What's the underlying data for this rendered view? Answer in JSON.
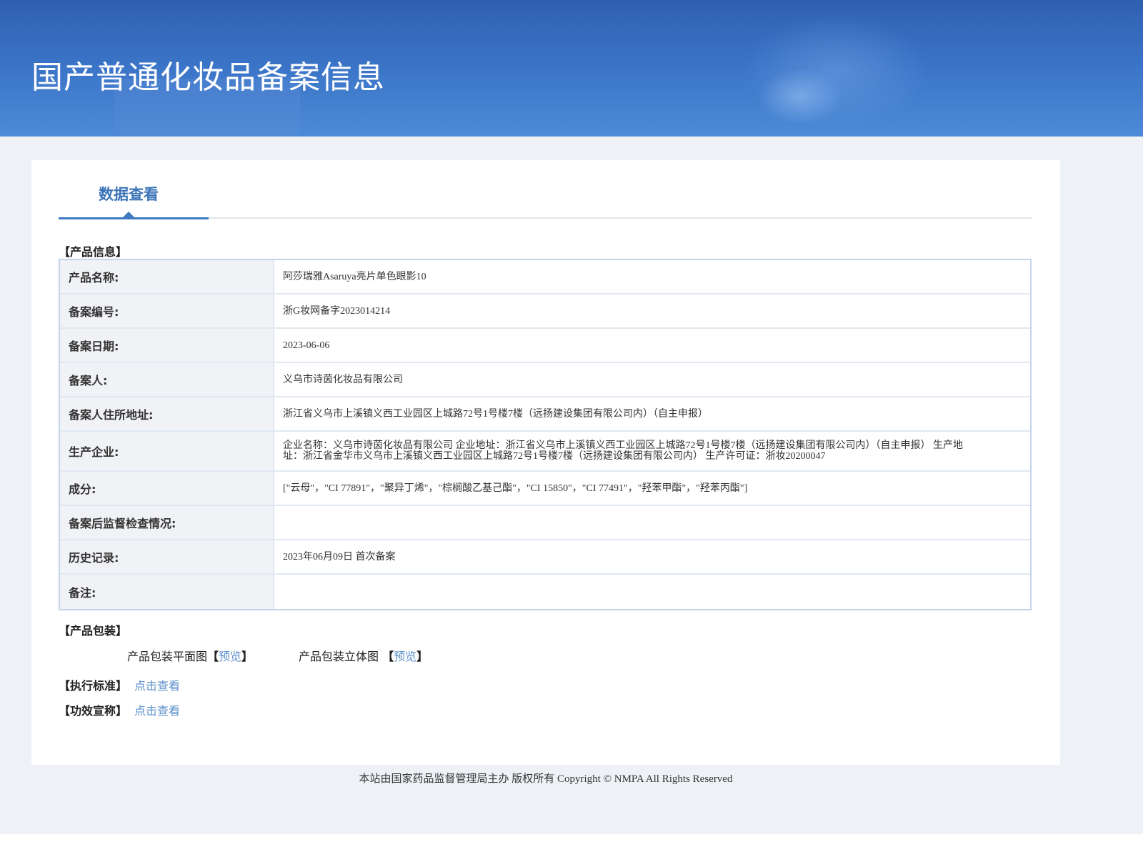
{
  "banner": {
    "title": "国产普通化妆品备案信息"
  },
  "tab": {
    "label": "数据查看"
  },
  "product_info": {
    "heading": "【产品信息】",
    "rows": [
      {
        "label": "产品名称:",
        "value": "阿莎瑞雅Asaruya亮片单色眼影10"
      },
      {
        "label": "备案编号:",
        "value": "浙G妆网备字2023014214"
      },
      {
        "label": "备案日期:",
        "value": "2023-06-06"
      },
      {
        "label": "备案人:",
        "value": "义乌市诗茵化妆品有限公司"
      },
      {
        "label": "备案人住所地址:",
        "value": "浙江省义乌市上溪镇义西工业园区上城路72号1号楼7楼（远扬建设集团有限公司内）（自主申报）"
      },
      {
        "label": "生产企业:",
        "value": "企业名称：义乌市诗茵化妆品有限公司 企业地址：浙江省义乌市上溪镇义西工业园区上城路72号1号楼7楼（远扬建设集团有限公司内）（自主申报） 生产地址：浙江省金华市义乌市上溪镇义西工业园区上城路72号1号楼7楼（远扬建设集团有限公司内） 生产许可证：浙妆20200047"
      },
      {
        "label": "成分:",
        "value": "[\"云母\"，\"CI 77891\"，\"聚异丁烯\"，\"棕榈酸乙基己酯\"，\"CI 15850\"，\"CI 77491\"，\"羟苯甲酯\"，\"羟苯丙酯\"]"
      },
      {
        "label": "备案后监督检查情况:",
        "value": ""
      },
      {
        "label": "历史记录:",
        "value": "2023年06月09日 首次备案"
      },
      {
        "label": "备注:",
        "value": ""
      }
    ]
  },
  "packaging": {
    "heading": "【产品包装】",
    "flat_label": "产品包装平面图",
    "solid_label": "产品包装立体图 ",
    "bracket_open": "【",
    "bracket_close": "】",
    "preview": "预览"
  },
  "standard": {
    "heading": "【执行标准】",
    "link": "点击查看"
  },
  "efficacy": {
    "heading": "【功效宣称】",
    "link": "点击查看"
  },
  "footer": {
    "text": "本站由国家药品监督管理局主办 版权所有 Copyright © NMPA All Rights Reserved"
  }
}
